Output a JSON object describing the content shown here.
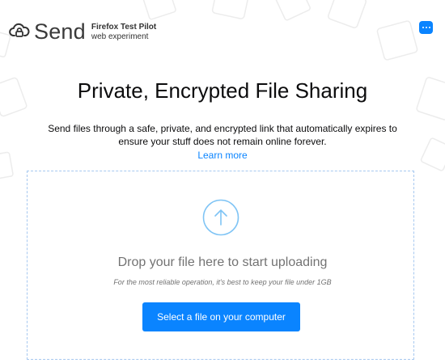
{
  "header": {
    "brand_name": "Send",
    "pilot_line1": "Firefox Test Pilot",
    "pilot_line2": "web experiment"
  },
  "main": {
    "title": "Private, Encrypted File Sharing",
    "description_line1": "Send files through a safe, private, and encrypted link that automatically expires to",
    "description_line2": "ensure your stuff does not remain online forever.",
    "learn_more": "Learn more"
  },
  "upload": {
    "drop_text": "Drop your file here to start uploading",
    "hint": "For the most reliable operation, it's best to keep your file under 1GB",
    "select_button": "Select a file on your computer"
  },
  "colors": {
    "accent": "#0a84ff",
    "dropzone_border": "#a6c8f0",
    "muted_text": "#737373"
  },
  "icons": {
    "brand": "send-cloud-icon",
    "feedback": "chat-bubble-icon",
    "upload": "upload-arrow-icon"
  }
}
